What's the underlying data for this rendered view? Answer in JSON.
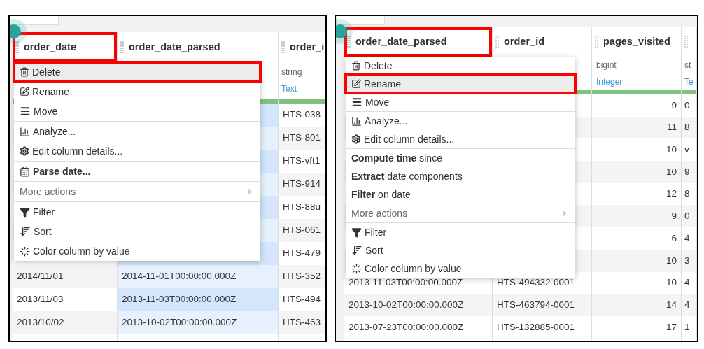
{
  "panels": [
    {
      "table": {
        "columns": [
          {
            "name": "order_date",
            "highlighted": true,
            "selected": false,
            "cells": [
              "2014/11/01",
              "2013/11/03",
              "2013/10/02"
            ]
          },
          {
            "name": "order_date_parsed",
            "highlighted": false,
            "selected": true,
            "cells": [
              "2014-11-01T00:00:00.000Z",
              "2013-11-03T00:00:00.000Z",
              "2013-10-02T00:00:00.000Z"
            ]
          },
          {
            "name": "order_i",
            "highlighted": false,
            "selected": false,
            "storage_type": "string",
            "meaning": "Text",
            "cells": [
              "HTS-038",
              "HTS-801",
              "HTS-vft1",
              "HTS-914",
              "HTS-88u",
              "HTS-061",
              "HTS-479",
              "HTS-352",
              "HTS-494",
              "HTS-463"
            ]
          }
        ]
      },
      "menu": {
        "sections": [
          {
            "items": [
              {
                "kind": "delete",
                "label": "Delete",
                "highlighted": true
              },
              {
                "kind": "rename",
                "label": "Rename",
                "highlighted": false
              },
              {
                "kind": "move",
                "label": "Move",
                "highlighted": false
              }
            ]
          },
          {
            "items": [
              {
                "kind": "analyze",
                "label": "Analyze...",
                "highlighted": false
              },
              {
                "kind": "details",
                "label": "Edit column details...",
                "highlighted": false
              }
            ]
          },
          {
            "items": [
              {
                "kind": "parse",
                "label": "**Parse date...**",
                "highlighted": false
              }
            ]
          },
          {
            "items": [
              {
                "kind": "submenu",
                "label": "More actions",
                "highlighted": false
              }
            ]
          },
          {
            "items": [
              {
                "kind": "filter",
                "label": "Filter",
                "highlighted": false
              },
              {
                "kind": "sort",
                "label": "Sort",
                "highlighted": false
              },
              {
                "kind": "color",
                "label": "Color column by value",
                "highlighted": false
              }
            ]
          }
        ]
      }
    },
    {
      "table": {
        "columns": [
          {
            "name": "order_date_parsed",
            "highlighted": true,
            "selected": false,
            "cells": [
              "2013-11-03T00:00:00.000Z",
              "2013-10-02T00:00:00.000Z",
              "2013-07-23T00:00:00.000Z"
            ]
          },
          {
            "name": "order_id",
            "highlighted": false,
            "selected": false,
            "cells": [
              "HTS-494332-0001",
              "HTS-463794-0001",
              "HTS-132885-0001"
            ]
          },
          {
            "name": "pages_visited",
            "highlighted": false,
            "selected": false,
            "storage_type": "bigint",
            "meaning": "Integer",
            "kind": "number",
            "cells": [
              "9",
              "11",
              "10",
              "10",
              "12",
              "9",
              "6",
              "10",
              "10",
              "14",
              "17"
            ]
          },
          {
            "highlighted": false,
            "selected": false,
            "storage_type": "st",
            "meaning": "Te",
            "cells": [
              "0",
              "8",
              "v",
              "9",
              "8",
              "0",
              "4",
              "3",
              "4",
              "4",
              "1"
            ]
          }
        ]
      },
      "menu": {
        "sections": [
          {
            "items": [
              {
                "kind": "delete",
                "label": "Delete",
                "highlighted": false
              },
              {
                "kind": "rename",
                "label": "Rename",
                "highlighted": true
              },
              {
                "kind": "move",
                "label": "Move",
                "highlighted": false
              }
            ]
          },
          {
            "items": [
              {
                "kind": "analyze",
                "label": "Analyze...",
                "highlighted": false
              },
              {
                "kind": "details",
                "label": "Edit column details...",
                "highlighted": false
              }
            ]
          },
          {
            "items": [
              {
                "kind": "plain",
                "label": "**Compute time** since",
                "highlighted": false
              },
              {
                "kind": "plain",
                "label": "**Extract** date components",
                "highlighted": false
              },
              {
                "kind": "plain",
                "label": "**Filter** on date",
                "highlighted": false
              }
            ]
          },
          {
            "items": [
              {
                "kind": "submenu",
                "label": "More actions",
                "highlighted": false
              }
            ]
          },
          {
            "items": [
              {
                "kind": "filter",
                "label": "Filter",
                "highlighted": false
              },
              {
                "kind": "sort",
                "label": "Sort",
                "highlighted": false
              },
              {
                "kind": "color",
                "label": "Color column by value",
                "highlighted": false
              }
            ]
          }
        ]
      }
    }
  ]
}
